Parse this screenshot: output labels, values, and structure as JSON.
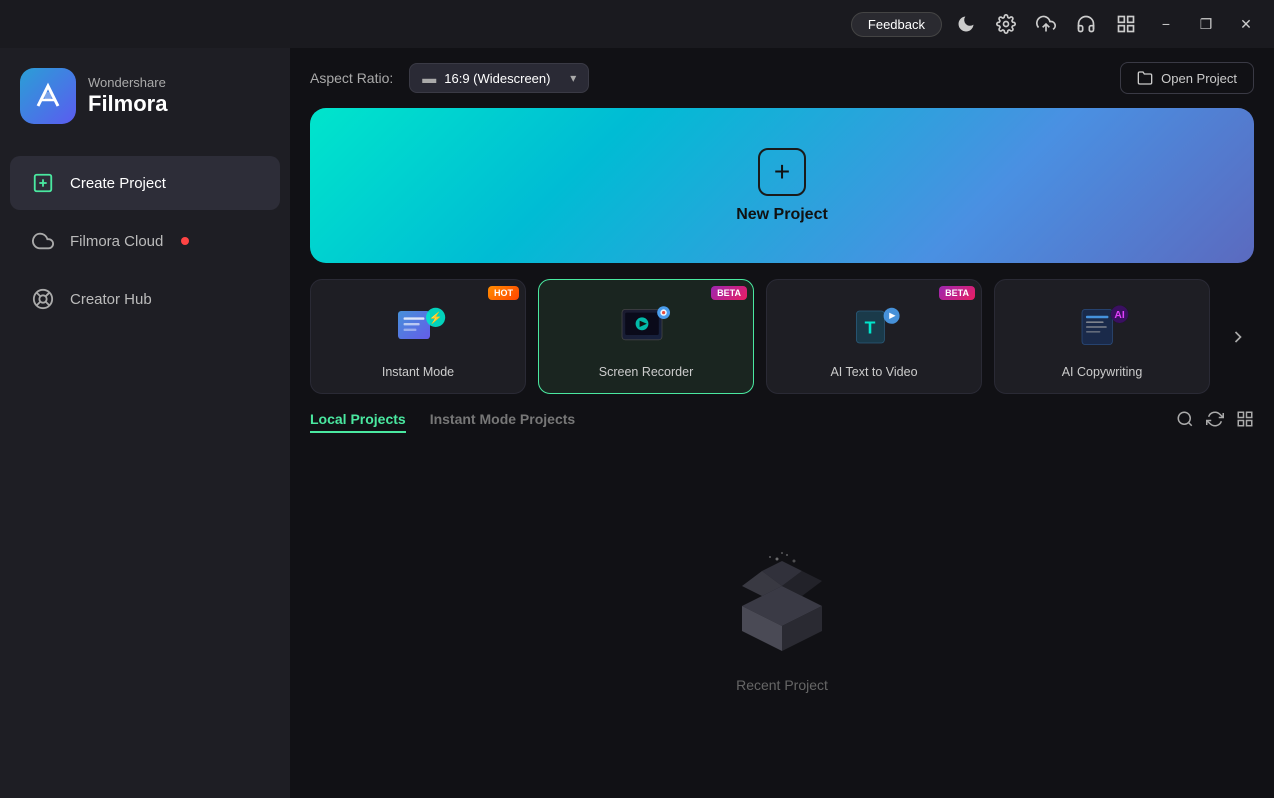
{
  "app": {
    "company": "Wondershare",
    "product": "Filmora"
  },
  "titlebar": {
    "feedback_label": "Feedback",
    "minimize_label": "−",
    "restore_label": "❐",
    "close_label": "✕"
  },
  "sidebar": {
    "items": [
      {
        "id": "create-project",
        "label": "Create Project",
        "active": true
      },
      {
        "id": "filmora-cloud",
        "label": "Filmora Cloud",
        "has_dot": true
      },
      {
        "id": "creator-hub",
        "label": "Creator Hub",
        "has_dot": false
      }
    ]
  },
  "content": {
    "aspect_ratio": {
      "label": "Aspect Ratio:",
      "value": "16:9 (Widescreen)"
    },
    "open_project": "Open Project",
    "new_project": "New Project",
    "shortcuts": [
      {
        "id": "instant-mode",
        "label": "Instant Mode",
        "badge": "HOT",
        "badge_type": "hot"
      },
      {
        "id": "screen-recorder",
        "label": "Screen Recorder",
        "badge": "BETA",
        "badge_type": "beta",
        "selected": true
      },
      {
        "id": "ai-text-to-video",
        "label": "AI Text to Video",
        "badge": "BETA",
        "badge_type": "beta"
      },
      {
        "id": "ai-copywriting",
        "label": "AI Copywriting",
        "badge": null
      }
    ],
    "tabs": [
      {
        "id": "local-projects",
        "label": "Local Projects",
        "active": true
      },
      {
        "id": "instant-mode-projects",
        "label": "Instant Mode Projects",
        "active": false
      }
    ],
    "empty_state": {
      "label": "Recent Project"
    }
  }
}
